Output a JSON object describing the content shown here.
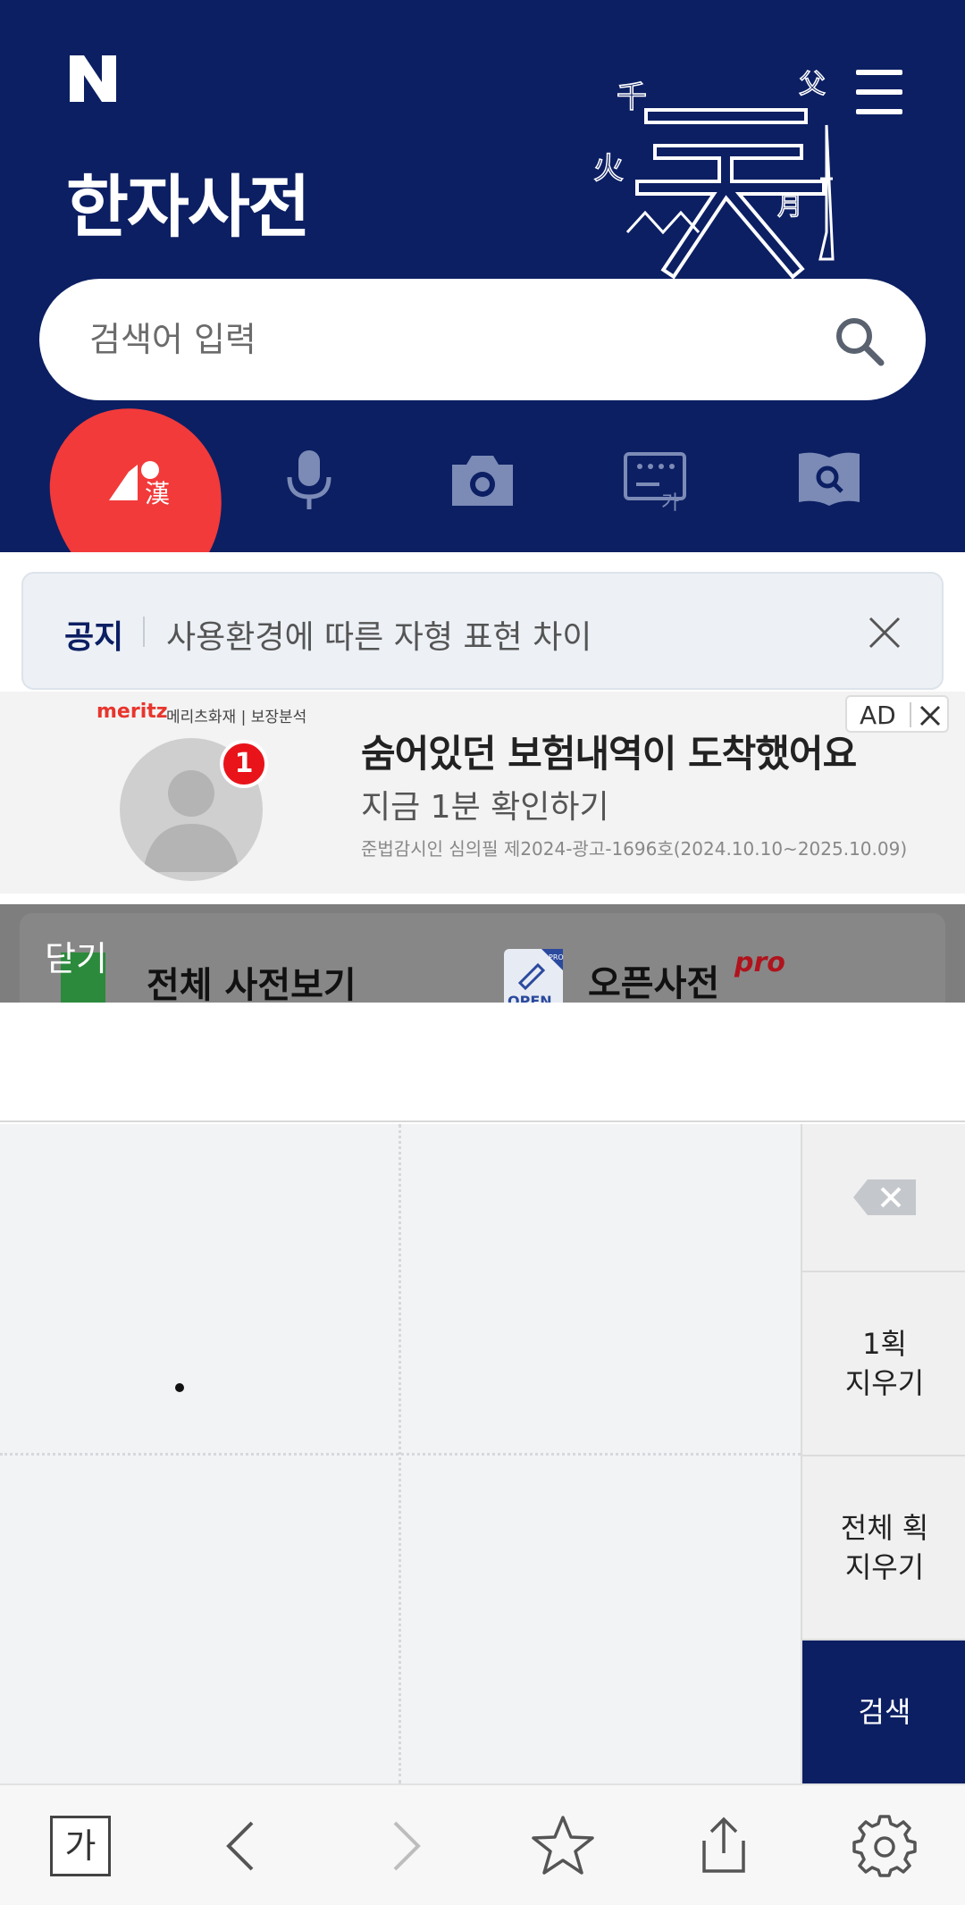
{
  "header": {
    "logo": "N",
    "title": "한자사전",
    "menu_icon": "hamburger-icon",
    "deco_chars": [
      "千",
      "火",
      "天",
      "月",
      "父"
    ]
  },
  "search": {
    "placeholder": "검색어 입력",
    "value": "",
    "icon": "search-icon"
  },
  "tools": [
    {
      "name": "hanja-input",
      "icon": "hanja-icon",
      "glyph": "漢"
    },
    {
      "name": "voice-search",
      "icon": "microphone-icon"
    },
    {
      "name": "camera-search",
      "icon": "camera-icon"
    },
    {
      "name": "handwriting-keyboard",
      "icon": "keyboard-icon",
      "glyph": "가"
    },
    {
      "name": "dictionary-search",
      "icon": "book-search-icon"
    }
  ],
  "notice": {
    "label": "공지",
    "text": "사용환경에 따른 자형 표현 차이"
  },
  "ad": {
    "brand": "meritz",
    "brand_sub": "메리츠화재 | 보장분석",
    "badge": "1",
    "title": "숨어있던 보험내역이 도착했어요",
    "subtitle": "지금 1분 확인하기",
    "fine_print": "준법감시인 심의필 제2024-광고-1696호(2024.10.10~2025.10.09)",
    "tag": "AD"
  },
  "overlay": {
    "close": "닫기",
    "all_dict": "전체 사전보기",
    "open_dict": "오픈사전",
    "pro": "pro",
    "open_label": "OPEN",
    "pro_badge": "PRO"
  },
  "handwriting": {
    "back_icon": "backspace-icon",
    "undo_one": [
      "1획",
      "지우기"
    ],
    "undo_all": [
      "전체 획",
      "지우기"
    ],
    "search": "검색"
  },
  "toolbar": {
    "font_button": "가",
    "icons": [
      "back-icon",
      "forward-icon",
      "star-icon",
      "share-icon",
      "gear-icon"
    ]
  },
  "colors": {
    "brand_navy": "#0c1f63",
    "annotation_red": "#f23a3a",
    "ad_brand_red": "#e8352d"
  }
}
